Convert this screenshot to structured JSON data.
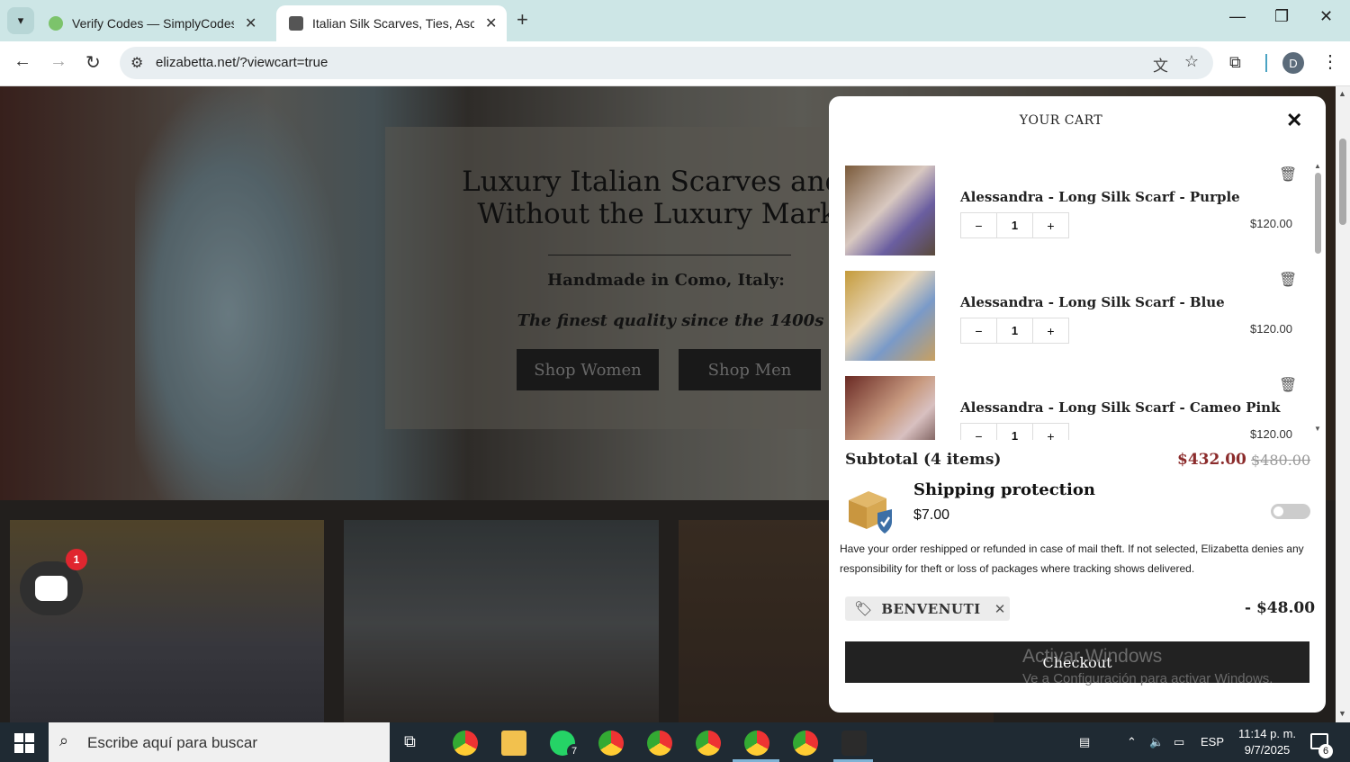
{
  "browser": {
    "tabs": [
      {
        "title": "Verify Codes — SimplyCodes",
        "icon": "simplycodes-favicon"
      },
      {
        "title": "Italian Silk Scarves, Ties, Ascots,",
        "icon": "elizabetta-favicon"
      }
    ],
    "url": "elizabetta.net/?viewcart=true",
    "profile_initial": "D"
  },
  "hero": {
    "title": "Luxury Italian Scarves and T\nWithout the Luxury Marku",
    "subtitle": "Handmade in Como, Italy:",
    "tagline": "The finest quality since the 1400s",
    "shop_women": "Shop Women",
    "shop_men": "Shop Men"
  },
  "chat": {
    "badge": "1"
  },
  "cart": {
    "title": "YOUR CART",
    "items": [
      {
        "name": "Alessandra - Long Silk Scarf - Purple",
        "qty": "1",
        "price": "$120.00"
      },
      {
        "name": "Alessandra - Long Silk Scarf - Blue",
        "qty": "1",
        "price": "$120.00"
      },
      {
        "name": "Alessandra - Long Silk Scarf - Cameo Pink",
        "qty": "1",
        "price": "$120.00"
      }
    ],
    "subtotal_label": "Subtotal (4 items)",
    "subtotal_price": "$432.00",
    "subtotal_original": "$480.00",
    "shipping_title": "Shipping protection",
    "shipping_price": "$7.00",
    "shipping_enabled": false,
    "shipping_desc": "Have your order reshipped or refunded in case of mail theft. If not selected, Elizabetta denies any responsibility for theft or loss of packages where tracking shows delivered.",
    "coupon_code": "BENVENUTI",
    "discount": "- $48.00",
    "checkout_label": "Checkout"
  },
  "watermark": {
    "line1": "Activar Windows",
    "line2": "Ve a Configuración para activar Windows."
  },
  "taskbar": {
    "search_placeholder": "Escribe aquí para buscar",
    "whatsapp_badge": "7",
    "language": "ESP",
    "time": "11:14 p. m.",
    "date": "9/7/2025",
    "notification_count": "6"
  },
  "colors": {
    "accent_price": "#8b2b2b",
    "checkout_bg": "#222222",
    "tab_strip": "#cde6e6"
  }
}
